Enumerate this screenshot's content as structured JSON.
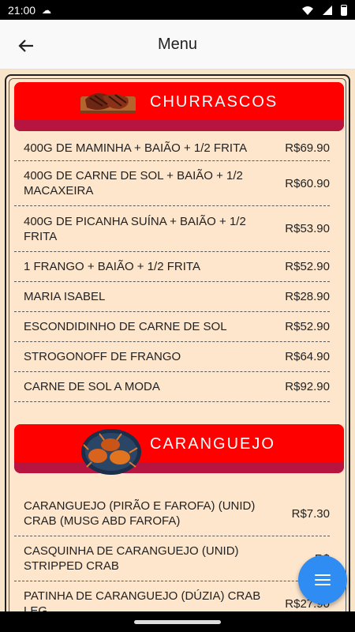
{
  "status": {
    "time": "21:00"
  },
  "appbar": {
    "title": "Menu"
  },
  "categories": [
    {
      "label": "CHURRASCOS",
      "icon": "grilled-meat-icon",
      "items": [
        {
          "name": "400G DE MAMINHA + BAIÃO + 1/2 FRITA",
          "price": "R$69.90"
        },
        {
          "name": "400G DE CARNE DE SOL + BAIÃO + 1/2 MACAXEIRA",
          "price": "R$60.90"
        },
        {
          "name": "400G DE PICANHA SUÍNA + BAIÃO + 1/2 FRITA",
          "price": "R$53.90"
        },
        {
          "name": "1 FRANGO + BAIÃO + 1/2 FRITA",
          "price": "R$52.90"
        },
        {
          "name": "MARIA ISABEL",
          "price": "R$28.90"
        },
        {
          "name": "ESCONDIDINHO DE CARNE DE SOL",
          "price": "R$52.90"
        },
        {
          "name": "STROGONOFF DE FRANGO",
          "price": "R$64.90"
        },
        {
          "name": "CARNE DE SOL A MODA",
          "price": "R$92.90"
        }
      ]
    },
    {
      "label": "CARANGUEJO",
      "icon": "crab-dish-icon",
      "items": [
        {
          "name": "CARANGUEJO (PIRÃO E FAROFA) (UNID) CRAB (MUSG ABD FAROFA)",
          "price": "R$7.30"
        },
        {
          "name": "CASQUINHA DE CARANGUEJO (UNID) STRIPPED CRAB",
          "price": "R$"
        },
        {
          "name": "PATINHA DE CARANGUEJO (DÚZIA) CRAB LEG",
          "price": "R$27.90"
        }
      ]
    }
  ],
  "fab": {
    "icon": "menu-lines-icon"
  }
}
